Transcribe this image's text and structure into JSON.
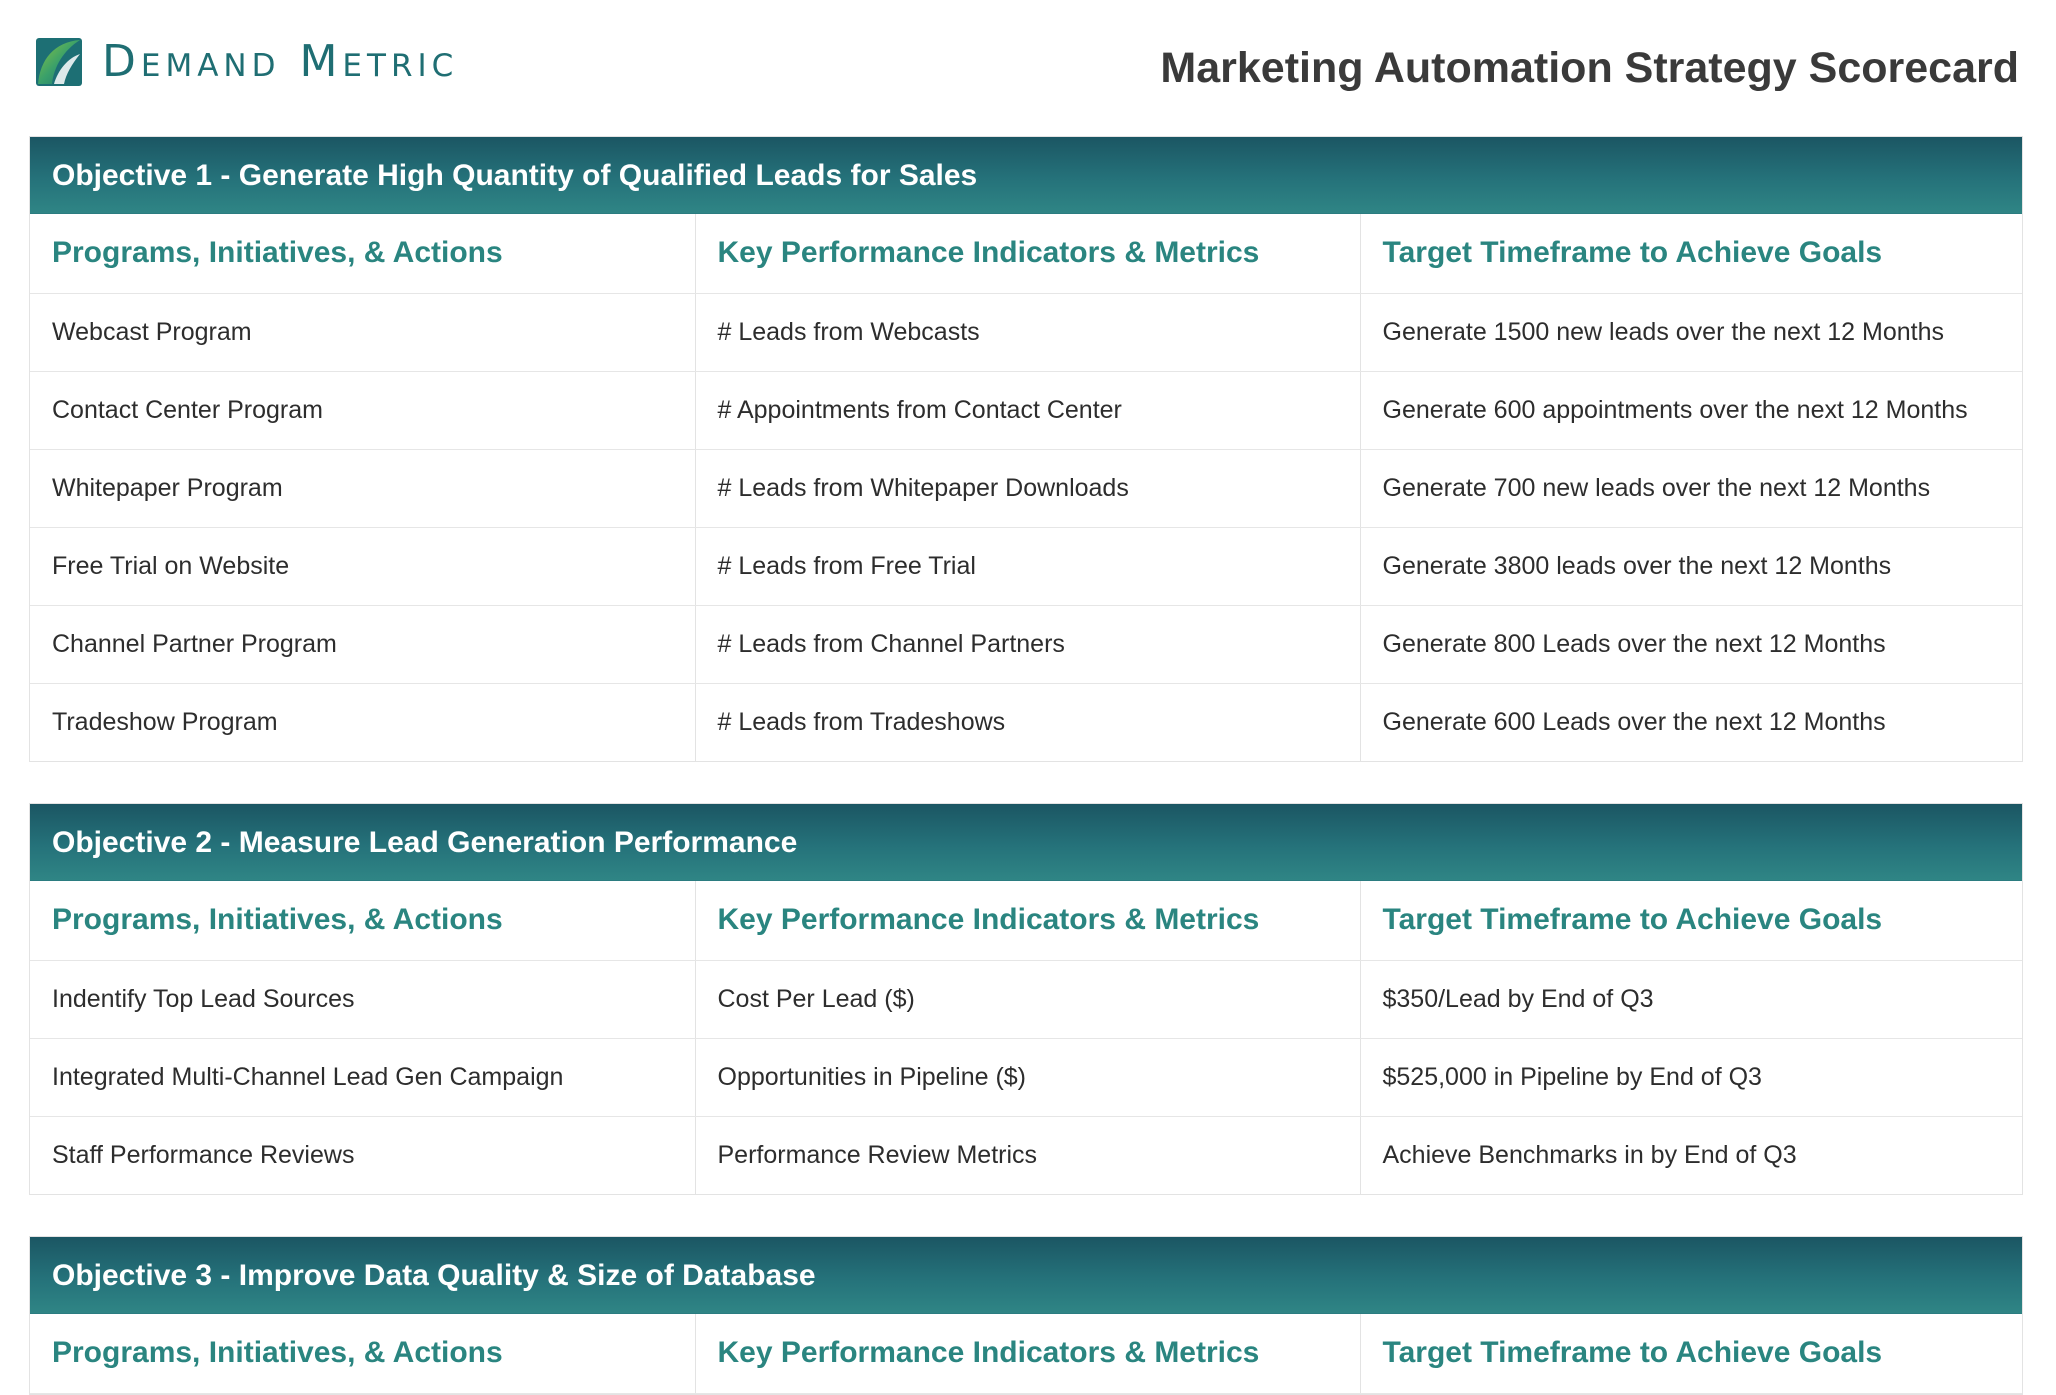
{
  "brand": {
    "logo_text": "Demand Metric",
    "logo_icon": "leaf-swoosh-logo-icon"
  },
  "document": {
    "title": "Marketing Automation Strategy Scorecard"
  },
  "colors": {
    "accent": "#2a8580",
    "bar_dark": "#1b5663",
    "bar_light": "#2f8585"
  },
  "columns": {
    "programs": "Programs, Initiatives, & Actions",
    "kpis": "Key Performance Indicators & Metrics",
    "timeframe": "Target Timeframe to Achieve Goals"
  },
  "objectives": [
    {
      "title": "Objective 1 - Generate High Quantity of Qualified Leads for Sales",
      "rows": [
        {
          "program": "Webcast Program",
          "kpi": "# Leads from Webcasts",
          "target": "Generate 1500 new leads over the next 12 Months"
        },
        {
          "program": "Contact Center Program",
          "kpi": "# Appointments from Contact Center",
          "target": "Generate 600 appointments over the next 12 Months"
        },
        {
          "program": "Whitepaper Program",
          "kpi": "# Leads from Whitepaper Downloads",
          "target": "Generate 700 new leads over the next 12 Months"
        },
        {
          "program": "Free Trial on Website",
          "kpi": "# Leads from Free Trial",
          "target": "Generate 3800 leads over the next 12 Months"
        },
        {
          "program": "Channel Partner Program",
          "kpi": "# Leads from Channel Partners",
          "target": "Generate 800 Leads over the next 12 Months"
        },
        {
          "program": "Tradeshow Program",
          "kpi": "# Leads from Tradeshows",
          "target": "Generate 600 Leads over the next 12 Months"
        }
      ]
    },
    {
      "title": "Objective 2 - Measure Lead Generation Performance",
      "rows": [
        {
          "program": "Indentify Top Lead Sources",
          "kpi": "Cost Per Lead ($)",
          "target": "$350/Lead by End of Q3"
        },
        {
          "program": "Integrated Multi-Channel Lead Gen Campaign",
          "kpi": "Opportunities in Pipeline ($)",
          "target": "$525,000 in Pipeline by End of Q3"
        },
        {
          "program": "Staff Performance Reviews",
          "kpi": "Performance Review Metrics",
          "target": "Achieve Benchmarks in by End of Q3"
        }
      ]
    },
    {
      "title": "Objective 3 - Improve Data Quality & Size of Database",
      "rows": []
    }
  ]
}
